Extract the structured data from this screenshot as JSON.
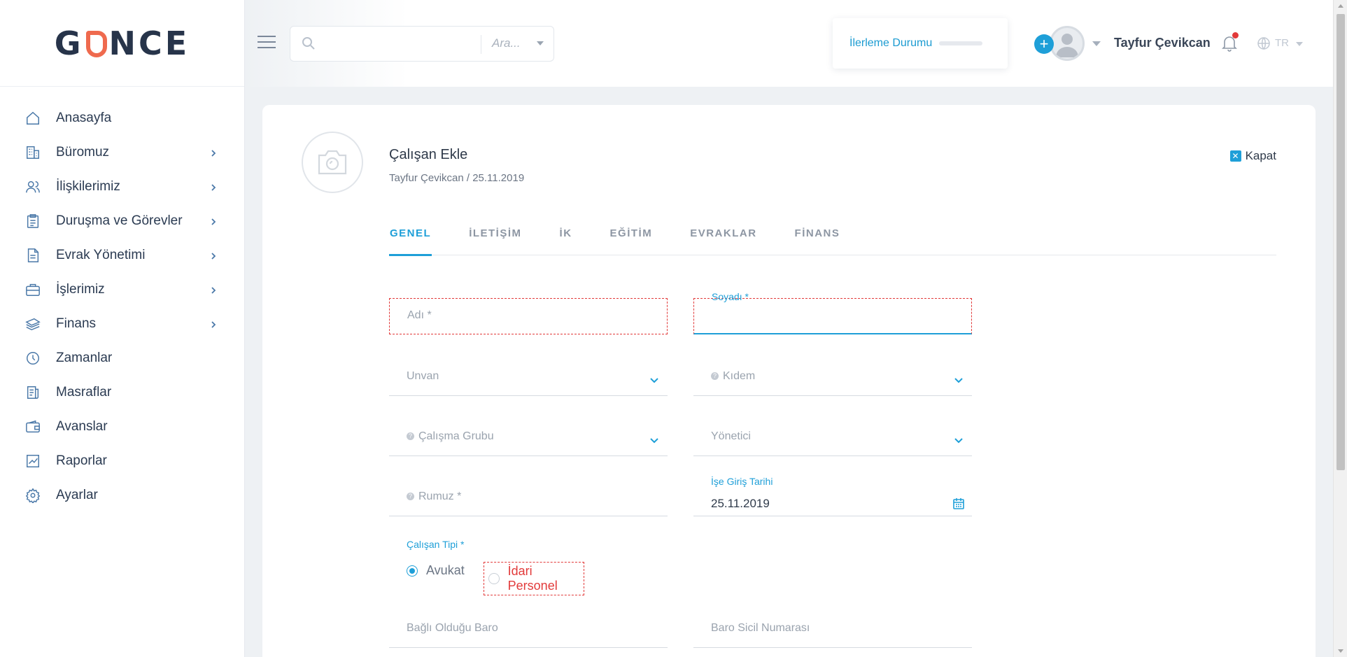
{
  "logo": {
    "before": "G",
    "after": "NCE"
  },
  "sidebar": {
    "items": [
      {
        "label": "Anasayfa",
        "icon": "home-icon",
        "has_submenu": false
      },
      {
        "label": "Büromuz",
        "icon": "building-icon",
        "has_submenu": true
      },
      {
        "label": "İlişkilerimiz",
        "icon": "users-icon",
        "has_submenu": true
      },
      {
        "label": "Duruşma ve Görevler",
        "icon": "clipboard-icon",
        "has_submenu": true
      },
      {
        "label": "Evrak Yönetimi",
        "icon": "document-icon",
        "has_submenu": true
      },
      {
        "label": "İşlerimiz",
        "icon": "briefcase-icon",
        "has_submenu": true
      },
      {
        "label": "Finans",
        "icon": "money-icon",
        "has_submenu": true
      },
      {
        "label": "Zamanlar",
        "icon": "clock-icon",
        "has_submenu": false
      },
      {
        "label": "Masraflar",
        "icon": "receipt-icon",
        "has_submenu": false
      },
      {
        "label": "Avanslar",
        "icon": "wallet-icon",
        "has_submenu": false
      },
      {
        "label": "Raporlar",
        "icon": "chart-icon",
        "has_submenu": false
      },
      {
        "label": "Ayarlar",
        "icon": "gear-icon",
        "has_submenu": false
      }
    ]
  },
  "search": {
    "value": "",
    "scope": "Ara..."
  },
  "progress": {
    "label": "İlerleme Durumu",
    "fraction": 0.0
  },
  "user": {
    "name": "Tayfur Çevikcan",
    "add_label": "+"
  },
  "language": {
    "code": "TR"
  },
  "form": {
    "title": "Çalışan Ekle",
    "subtitle": "Tayfur Çevikcan / 25.11.2019",
    "close_label": "Kapat",
    "tabs": [
      "GENEL",
      "İLETİŞİM",
      "İK",
      "EĞİTİM",
      "EVRAKLAR",
      "FİNANS"
    ],
    "active_tab": 0,
    "fields": {
      "first_name": {
        "label": "Adı *",
        "value": ""
      },
      "last_name": {
        "label": "Soyadı *",
        "value": ""
      },
      "title": {
        "label": "Unvan"
      },
      "seniority": {
        "label": "Kıdem"
      },
      "work_group": {
        "label": "Çalışma Grubu"
      },
      "manager": {
        "label": "Yönetici"
      },
      "nickname": {
        "label": "Rumuz *"
      },
      "start_date": {
        "label": "İşe Giriş Tarihi",
        "value": "25.11.2019"
      },
      "bar": {
        "label": "Bağlı Olduğu Baro"
      },
      "bar_number": {
        "label": "Baro Sicil Numarası"
      }
    },
    "employee_type": {
      "label": "Çalışan Tipi *",
      "options": [
        "Avukat",
        "İdari Personel"
      ],
      "selected": 0
    }
  },
  "colors": {
    "accent": "#1e9fd8",
    "error": "#e23a3a",
    "logo_accent": "#ef6a4e",
    "logo_text": "#27344a"
  }
}
